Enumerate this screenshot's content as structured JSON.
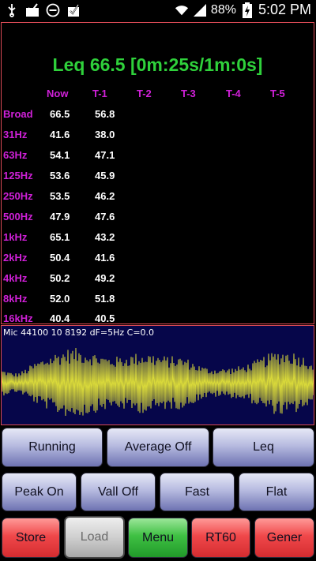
{
  "status_bar": {
    "battery": "88%",
    "time": "5:02 PM",
    "icons": [
      "usb-icon",
      "mail-check-icon",
      "do-not-disturb-icon",
      "clipboard-check-icon",
      "wifi-icon",
      "signal-icon",
      "battery-charging-icon"
    ]
  },
  "meter": {
    "leq_title": "Leq  66.5 [0m:25s/1m:0s]",
    "columns": [
      "Now",
      "T-1",
      "T-2",
      "T-3",
      "T-4",
      "T-5"
    ],
    "rows": [
      {
        "label": "Broad",
        "now": "66.5",
        "t1": "56.8"
      },
      {
        "label": "31Hz",
        "now": "41.6",
        "t1": "38.0"
      },
      {
        "label": "63Hz",
        "now": "54.1",
        "t1": "47.1"
      },
      {
        "label": "125Hz",
        "now": "53.6",
        "t1": "45.9"
      },
      {
        "label": "250Hz",
        "now": "53.5",
        "t1": "46.2"
      },
      {
        "label": "500Hz",
        "now": "47.9",
        "t1": "47.6"
      },
      {
        "label": "1kHz",
        "now": "65.1",
        "t1": "43.2"
      },
      {
        "label": "2kHz",
        "now": "50.4",
        "t1": "41.6"
      },
      {
        "label": "4kHz",
        "now": "50.2",
        "t1": "49.2"
      },
      {
        "label": "8kHz",
        "now": "52.0",
        "t1": "51.8"
      },
      {
        "label": "16kHz",
        "now": "40.4",
        "t1": "40.5"
      }
    ]
  },
  "waveform": {
    "label": "Mic 44100 10 8192 dF=5Hz C=0.0",
    "color": "#d8d83a",
    "background": "#06064a"
  },
  "buttons": {
    "row1": [
      "Running",
      "Average Off",
      "Leq"
    ],
    "row2": [
      "Peak On",
      "Vall Off",
      "Fast",
      "Flat"
    ],
    "row3": [
      "Store",
      "Load",
      "Menu",
      "RT60",
      "Gener"
    ]
  },
  "colors": {
    "accent_green": "#2fd13b",
    "label_magenta": "#d020d8",
    "panel_border": "#d94a55"
  }
}
